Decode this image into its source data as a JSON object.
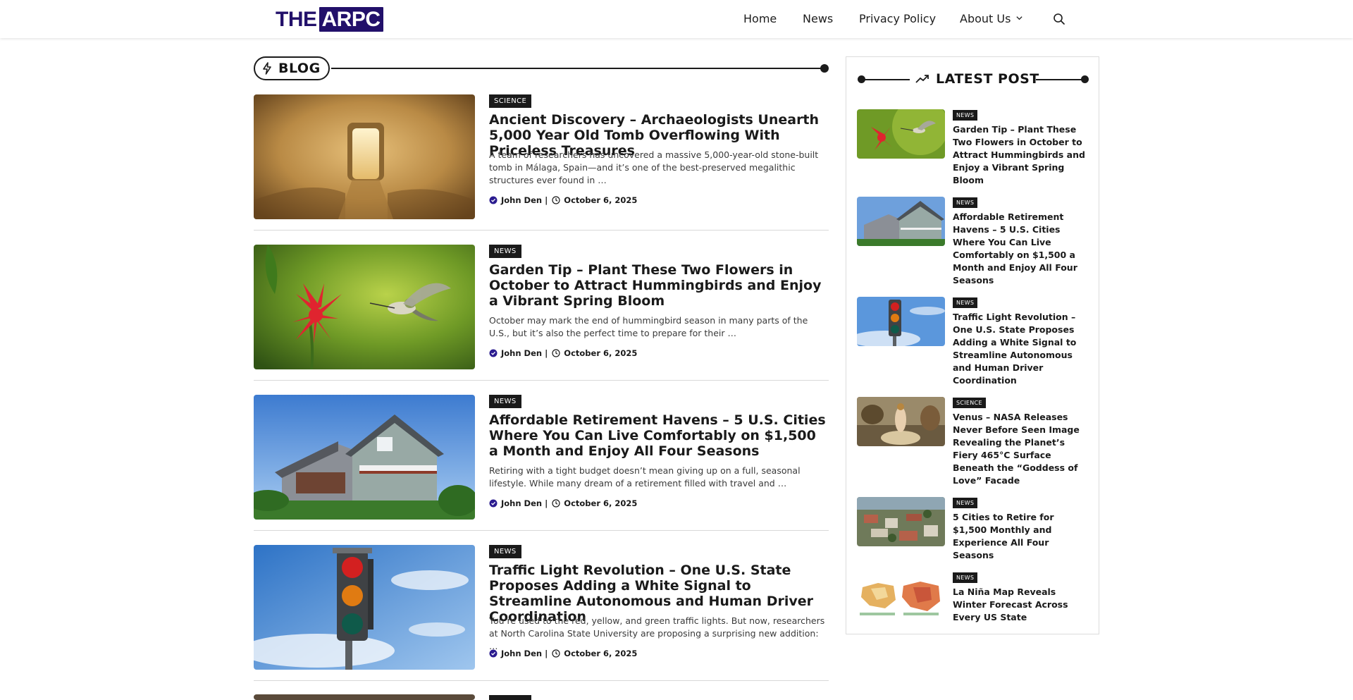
{
  "logo": {
    "part1": "THE",
    "part2": "ARPC"
  },
  "nav": {
    "home": "Home",
    "news": "News",
    "privacy": "Privacy Policy",
    "about": "About Us"
  },
  "blog": {
    "heading": "BLOG",
    "articles": [
      {
        "category": "SCIENCE",
        "title": "Ancient Discovery – Archaeologists Unearth 5,000 Year Old Tomb Overflowing With Priceless Treasures",
        "excerpt": "A team of researchers has uncovered a massive 5,000-year-old stone-built tomb in Málaga, Spain—and it’s one of the best-preserved megalithic structures ever found in …",
        "author": "John Den |",
        "date": "October 6, 2025"
      },
      {
        "category": "NEWS",
        "title": "Garden Tip – Plant These Two Flowers in October to Attract Hummingbirds and Enjoy a Vibrant Spring Bloom",
        "excerpt": "October may mark the end of hummingbird season in many parts of the U.S., but it’s also the perfect time to prepare for their …",
        "author": "John Den |",
        "date": "October 6, 2025"
      },
      {
        "category": "NEWS",
        "title": "Affordable Retirement Havens – 5 U.S. Cities Where You Can Live Comfortably on $1,500 a Month and Enjoy All Four Seasons",
        "excerpt": "Retiring with a tight budget doesn’t mean giving up on a full, seasonal lifestyle. While many dream of a retirement filled with travel and …",
        "author": "John Den |",
        "date": "October 6, 2025"
      },
      {
        "category": "NEWS",
        "title": "Traffic Light Revolution – One U.S. State Proposes Adding a White Signal to Streamline Autonomous and Human Driver Coordination",
        "excerpt": "You’re used to the red, yellow, and green traffic lights. But now, researchers at North Carolina State University are proposing a surprising new addition: …",
        "author": "John Den |",
        "date": "October 6, 2025"
      }
    ]
  },
  "sidebar": {
    "heading": "LATEST POST",
    "posts": [
      {
        "category": "NEWS",
        "title": "Garden Tip – Plant These Two Flowers in October to Attract Hummingbirds and Enjoy a Vibrant Spring Bloom"
      },
      {
        "category": "NEWS",
        "title": "Affordable Retirement Havens – 5 U.S. Cities Where You Can Live Comfortably on $1,500 a Month and Enjoy All Four Seasons"
      },
      {
        "category": "NEWS",
        "title": "Traffic Light Revolution – One U.S. State Proposes Adding a White Signal to Streamline Autonomous and Human Driver Coordination"
      },
      {
        "category": "SCIENCE",
        "title": "Venus – NASA Releases Never Before Seen Image Revealing the Planet’s Fiery 465°C Surface Beneath the “Goddess of Love” Facade"
      },
      {
        "category": "NEWS",
        "title": "5 Cities to Retire for $1,500 Monthly and Experience All Four Seasons"
      },
      {
        "category": "NEWS",
        "title": "La Niña Map Reveals Winter Forecast Across Every US State"
      }
    ]
  },
  "colors": {
    "brand": "#22106a",
    "category_bg": "#1a1a1a",
    "author_icon": "#2a1b8f"
  }
}
